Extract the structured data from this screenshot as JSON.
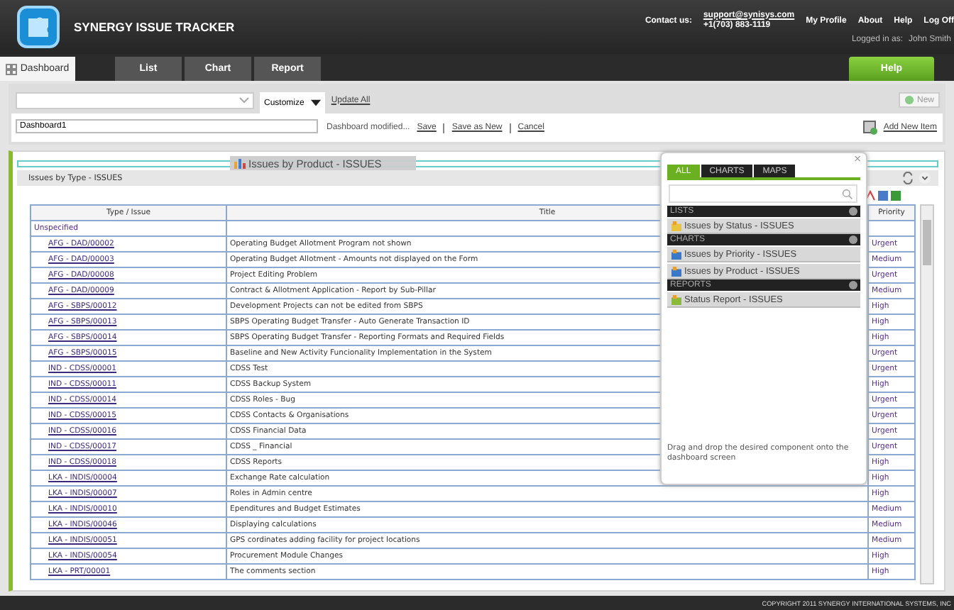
{
  "header": {
    "app_title": "SYNERGY ISSUE TRACKER",
    "contact_label": "Contact us:",
    "email": "support@synisys.com",
    "phone": "+1(703) 883-1119",
    "links": [
      "My Profile",
      "About",
      "Help",
      "Log Off"
    ],
    "logged_in_label": "Logged in as:",
    "user_name": "John  Smith"
  },
  "tabs": [
    {
      "label": "Dashboard",
      "selected": true
    },
    {
      "label": "List",
      "selected": false
    },
    {
      "label": "Chart",
      "selected": false
    },
    {
      "label": "Report",
      "selected": false
    }
  ],
  "help_button": "Help",
  "toolbar": {
    "customize": "Customize",
    "update_all": "Update All",
    "new_button": "New",
    "dashboard_name": "Dashboard1",
    "status": "Dashboard modified...",
    "actions": [
      "Save",
      "Save as New",
      "Cancel"
    ],
    "add_new_item": "Add New Item"
  },
  "drag_item": "Issues by Product - ISSUES",
  "widget": {
    "title": "Issues by Type - ISSUES",
    "columns": [
      "Type / Issue",
      "Title",
      "Priority"
    ],
    "rows": [
      {
        "kind": "group",
        "type_issue": "Unspecified",
        "title": "",
        "priority": ""
      },
      {
        "kind": "issue",
        "type_issue": "AFG - DAD/00002",
        "title": "Operating Budget Allotment Program not shown",
        "priority": "Urgent"
      },
      {
        "kind": "issue",
        "type_issue": "AFG - DAD/00003",
        "title": "Operating Budget Allotment - Amounts not displayed on the Form",
        "priority": "Medium"
      },
      {
        "kind": "issue",
        "type_issue": "AFG - DAD/00008",
        "title": "Project Editing Problem",
        "priority": "Urgent"
      },
      {
        "kind": "issue",
        "type_issue": "AFG - DAD/00009",
        "title": "Contract & Allotment Application - Report by Sub-Pillar",
        "priority": "Medium"
      },
      {
        "kind": "issue",
        "type_issue": "AFG - SBPS/00012",
        "title": "Development Projects can not be edited from SBPS",
        "priority": "High"
      },
      {
        "kind": "issue",
        "type_issue": "AFG - SBPS/00013",
        "title": "SBPS Operating Budget Transfer - Auto Generate Transaction ID",
        "priority": "High"
      },
      {
        "kind": "issue",
        "type_issue": "AFG - SBPS/00014",
        "title": "SBPS Operating Budget Transfer - Reporting Formats and Required Fields",
        "priority": "High"
      },
      {
        "kind": "issue",
        "type_issue": "AFG - SBPS/00015",
        "title": "Baseline and New Activity Funcionality Implementation in the System",
        "priority": "Urgent"
      },
      {
        "kind": "issue",
        "type_issue": "IND - CDSS/00001",
        "title": "CDSS Test",
        "priority": "Urgent"
      },
      {
        "kind": "issue",
        "type_issue": "IND - CDSS/00011",
        "title": "CDSS Backup System",
        "priority": "High"
      },
      {
        "kind": "issue",
        "type_issue": "IND - CDSS/00014",
        "title": "CDSS Roles - Bug",
        "priority": "Urgent"
      },
      {
        "kind": "issue",
        "type_issue": "IND - CDSS/00015",
        "title": "CDSS Contacts & Organisations",
        "priority": "Urgent"
      },
      {
        "kind": "issue",
        "type_issue": "IND - CDSS/00016",
        "title": "CDSS Financial Data",
        "priority": "Urgent"
      },
      {
        "kind": "issue",
        "type_issue": "IND - CDSS/00017",
        "title": "CDSS _ Financial",
        "priority": "Urgent"
      },
      {
        "kind": "issue",
        "type_issue": "IND - CDSS/00018",
        "title": "CDSS Reports",
        "priority": "High"
      },
      {
        "kind": "issue",
        "type_issue": "LKA - INDIS/00004",
        "title": "Exchange Rate calculation",
        "priority": "High"
      },
      {
        "kind": "issue",
        "type_issue": "LKA - INDIS/00007",
        "title": "Roles in Admin centre",
        "priority": "High"
      },
      {
        "kind": "issue",
        "type_issue": "LKA - INDIS/00010",
        "title": "Ependitures and Budget Estimates",
        "priority": "Medium"
      },
      {
        "kind": "issue",
        "type_issue": "LKA - INDIS/00046",
        "title": "Displaying calculations",
        "priority": "Medium"
      },
      {
        "kind": "issue",
        "type_issue": "LKA - INDIS/00051",
        "title": "GPS cordinates adding facility for project locations",
        "priority": "Medium"
      },
      {
        "kind": "issue",
        "type_issue": "LKA - INDIS/00054",
        "title": "Procurement Module Changes",
        "priority": "High"
      },
      {
        "kind": "issue",
        "type_issue": "LKA - PRT/00001",
        "title": "The comments section",
        "priority": "High"
      }
    ]
  },
  "palette": {
    "close": "×",
    "tabs": [
      {
        "label": "ALL",
        "selected": true
      },
      {
        "label": "CHARTS",
        "selected": false
      },
      {
        "label": "MAPS",
        "selected": false
      }
    ],
    "sections": [
      {
        "heading": "LISTS",
        "items": [
          {
            "kind": "list",
            "label": "Issues by Status - ISSUES"
          }
        ]
      },
      {
        "heading": "CHARTS",
        "items": [
          {
            "kind": "chart",
            "label": "Issues by Priority - ISSUES"
          },
          {
            "kind": "chart",
            "label": "Issues by Product - ISSUES"
          }
        ]
      },
      {
        "heading": "REPORTS",
        "items": [
          {
            "kind": "report",
            "label": "Status Report - ISSUES"
          }
        ]
      }
    ],
    "hint": "Drag and drop the desired component onto the dashboard screen"
  },
  "footer": "COPYRIGHT 2011 SYNERGY INTERNATIONAL SYSTEMS, INC"
}
